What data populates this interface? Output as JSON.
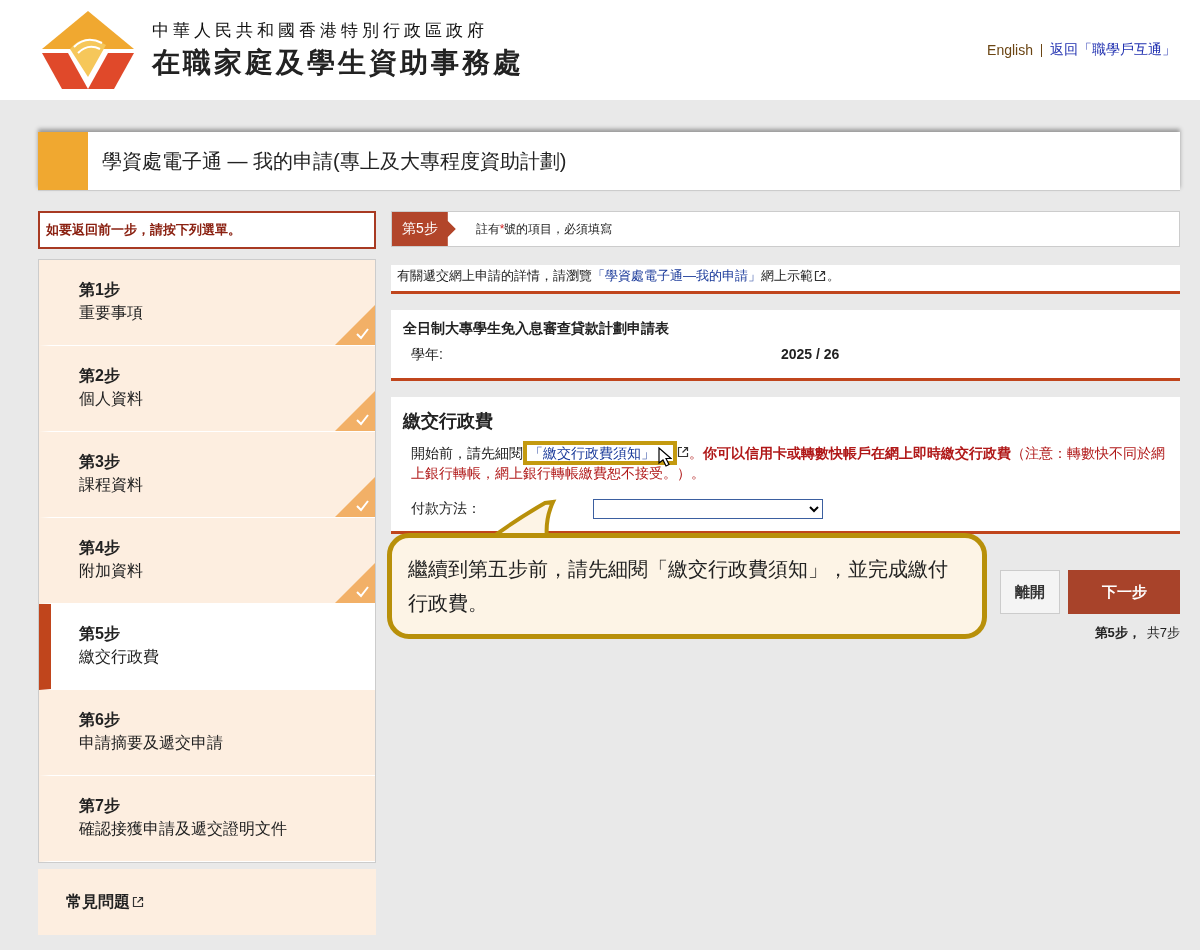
{
  "header": {
    "org_line": "中華人民共和國香港特別行政區政府",
    "org_name": "在職家庭及學生資助事務處",
    "links": [
      {
        "label": "English",
        "kind": "lang"
      },
      {
        "label": "返回「職學戶互通」",
        "kind": "link"
      }
    ]
  },
  "page_title": "學資處電子通 — 我的申請(專上及大專程度資助計劃)",
  "sidebar": {
    "back_hint": "如要返回前一步，請按下列選單。",
    "steps": [
      {
        "step": "第1步",
        "name": "重要事項",
        "completed": true,
        "selected": false
      },
      {
        "step": "第2步",
        "name": "個人資料",
        "completed": true,
        "selected": false
      },
      {
        "step": "第3步",
        "name": "課程資料",
        "completed": true,
        "selected": false
      },
      {
        "step": "第4步",
        "name": "附加資料",
        "completed": true,
        "selected": false
      },
      {
        "step": "第5步",
        "name": "繳交行政費",
        "completed": false,
        "selected": true
      },
      {
        "step": "第6步",
        "name": "申請摘要及遞交申請",
        "completed": false,
        "selected": false
      },
      {
        "step": "第7步",
        "name": "確認接獲申請及遞交證明文件",
        "completed": false,
        "selected": false
      }
    ],
    "faq": "常見問題"
  },
  "step_bar": {
    "badge": "第5步",
    "note_before": "註有",
    "required_mark": "*",
    "note_after": "號的項目，必須填寫"
  },
  "info": {
    "before": "有關遞交網上申請的詳情，請瀏覽",
    "link": "「學資處電子通—我的申請」",
    "after": "網上示範",
    "end": "。"
  },
  "form": {
    "title": "全日制大專學生免入息審查貸款計劃申請表",
    "year_label": "學年:",
    "year_value": "2025 / 26"
  },
  "fee": {
    "heading": "繳交行政費",
    "intro": "開始前，請先細閱",
    "link": "「繳交行政費須知」",
    "link_highlighted": true,
    "period": "。",
    "warning": "你可以信用卡或轉數快帳戶在網上即時繳交行政費",
    "note": "（注意：轉數快不同於網上銀行轉帳，網上銀行轉帳繳費恕不接受。）。",
    "method_label": "付款方法："
  },
  "buttons": [
    {
      "label": "離開",
      "kind": "secondary"
    },
    {
      "label": "下一步",
      "kind": "primary"
    }
  ],
  "progress": {
    "current": "第5步，",
    "total": "共7步"
  },
  "callout": {
    "text": "繼續到第五步前，請先細閱「繳交行政費須知」，並完成繳付行政費。"
  }
}
